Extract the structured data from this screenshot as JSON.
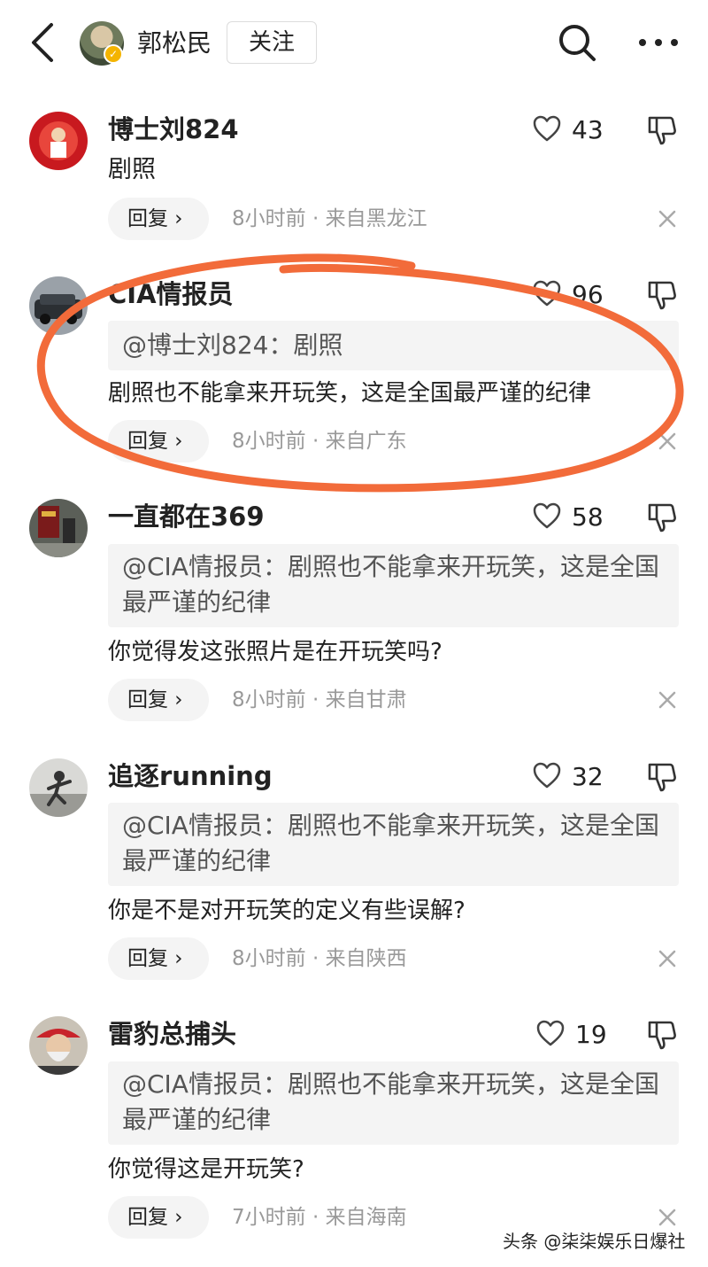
{
  "header": {
    "author_name": "郭松民",
    "follow_label": "关注",
    "icons": [
      "back-arrow-icon",
      "verified-badge-icon",
      "search-icon",
      "more-icon"
    ]
  },
  "comments": [
    {
      "name": "博士刘824",
      "likes": "43",
      "text": "剧照",
      "reply_label": "回复 ›",
      "time": "8小时前",
      "location": "来自黑龙江"
    },
    {
      "name": "CIA情报员",
      "likes": "96",
      "quote": "@博士刘824：剧照",
      "text": "剧照也不能拿来开玩笑，这是全国最严谨的纪律",
      "reply_label": "回复 ›",
      "time": "8小时前",
      "location": "来自广东"
    },
    {
      "name": "一直都在369",
      "likes": "58",
      "quote": "@CIA情报员：剧照也不能拿来开玩笑，这是全国最严谨的纪律",
      "text": "你觉得发这张照片是在开玩笑吗?",
      "reply_label": "回复 ›",
      "time": "8小时前",
      "location": "来自甘肃"
    },
    {
      "name": "追逐running",
      "likes": "32",
      "quote": "@CIA情报员：剧照也不能拿来开玩笑，这是全国最严谨的纪律",
      "text": "你是不是对开玩笑的定义有些误解?",
      "reply_label": "回复 ›",
      "time": "8小时前",
      "location": "来自陕西"
    },
    {
      "name": "雷豹总捕头",
      "likes": "19",
      "quote": "@CIA情报员：剧照也不能拿来开玩笑，这是全国最严谨的纪律",
      "text": "你觉得这是开玩笑?",
      "reply_label": "回复 ›",
      "time": "7小时前",
      "location": "来自海南"
    }
  ],
  "meta_separator": "·",
  "watermark": "头条 @柒柒娱乐日爆社",
  "colors": {
    "annotation_circle": "#f26b3a",
    "quote_bg": "#f4f4f4",
    "meta_text": "#999999",
    "verified_badge": "#f4b400"
  }
}
